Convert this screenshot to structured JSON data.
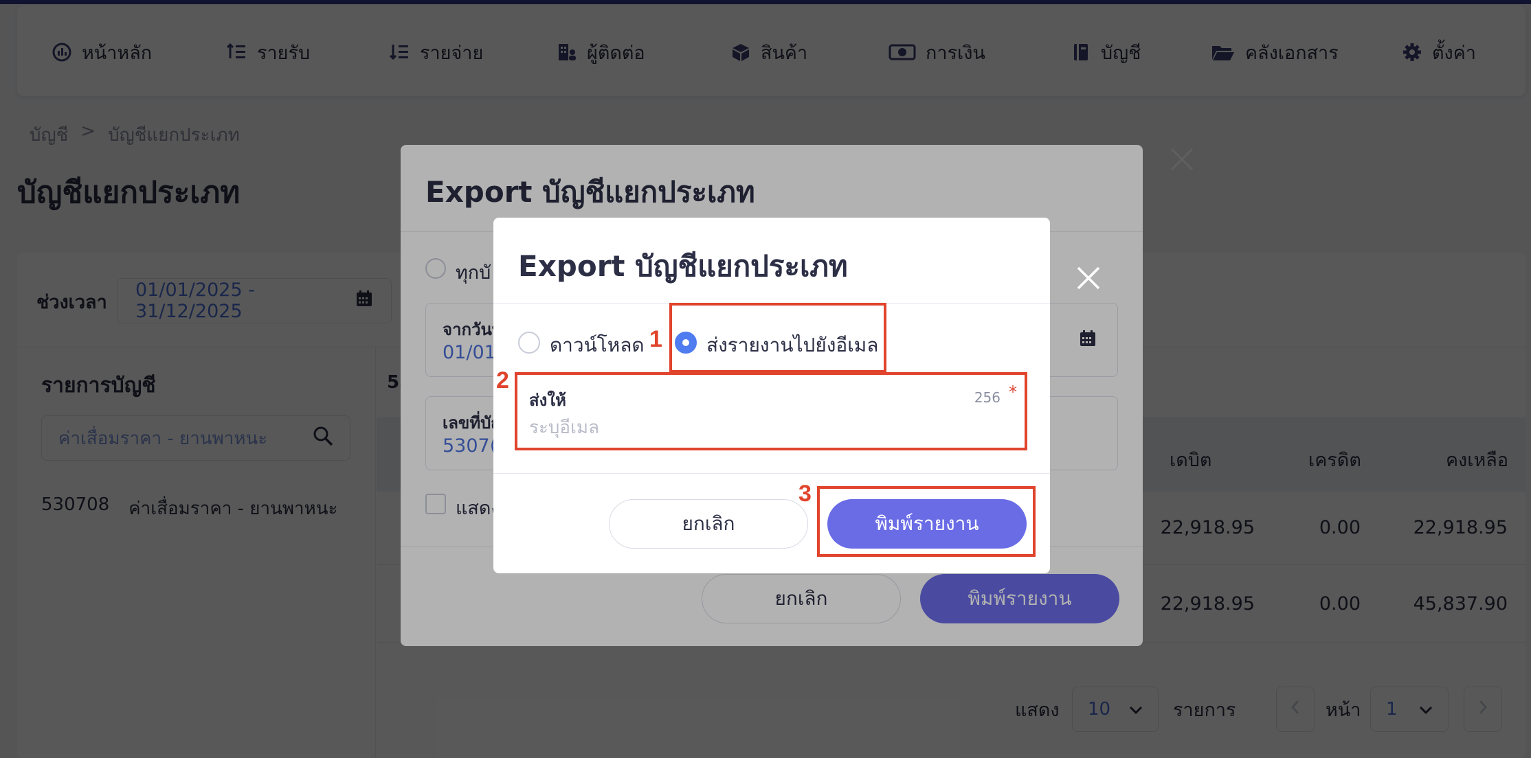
{
  "nav": {
    "items": [
      {
        "label": "หน้าหลัก",
        "icon": "dashboard-icon"
      },
      {
        "label": "รายรับ",
        "icon": "income-list-icon"
      },
      {
        "label": "รายจ่าย",
        "icon": "expense-list-icon"
      },
      {
        "label": "ผู้ติดต่อ",
        "icon": "contacts-building-icon"
      },
      {
        "label": "สินค้า",
        "icon": "box-icon"
      },
      {
        "label": "การเงิน",
        "icon": "money-icon"
      },
      {
        "label": "บัญชี",
        "icon": "book-icon"
      },
      {
        "label": "คลังเอกสาร",
        "icon": "folder-icon"
      },
      {
        "label": "ตั้งค่า",
        "icon": "gear-icon"
      }
    ]
  },
  "breadcrumb": {
    "root": "บัญชี",
    "separator": ">",
    "current": "บัญชีแยกประเภท"
  },
  "page": {
    "title": "บัญชีแยกประเภท",
    "period_label": "ช่วงเวลา",
    "period_value": "01/01/2025 - 31/12/2025"
  },
  "left_panel": {
    "title": "รายการบัญชี",
    "search_value": "ค่าเสื่อมราคา - ยานพาหนะ",
    "item_code": "530708",
    "item_name": "ค่าเสื่อมราคา - ยานพาหนะ"
  },
  "table": {
    "ghost_code": "53",
    "headers": {
      "debit": "เดบิต",
      "credit": "เครดิต",
      "balance": "คงเหลือ"
    },
    "rows": [
      {
        "debit": "22,918.95",
        "credit": "0.00",
        "balance": "22,918.95"
      },
      {
        "debit": "22,918.95",
        "credit": "0.00",
        "balance": "45,837.90"
      }
    ]
  },
  "pager": {
    "show_label": "แสดง",
    "page_size": "10",
    "items_label": "รายการ",
    "page_label": "หน้า",
    "page_value": "1"
  },
  "modal_back": {
    "title": "Export บัญชีแยกประเภท",
    "radio_partial": "ทุกบั",
    "from_label_partial": "จากวันที่",
    "from_value_partial": "01/01",
    "account_label_partial": "เลขที่บัญ",
    "account_value_partial": "5307(",
    "checkbox_partial": "แสดง",
    "cancel": "ยกเลิก",
    "print": "พิมพ์รายงาน"
  },
  "modal_front": {
    "title": "Export บัญชีแยกประเภท",
    "option_download": "ดาวน์โหลด",
    "option_email": "ส่งรายงานไปยังอีเมล",
    "selected_option": "email",
    "email_label": "ส่งให้",
    "email_counter": "256",
    "email_required_mark": "*",
    "email_placeholder": "ระบุอีเมล",
    "email_value": "",
    "cancel": "ยกเลิก",
    "print": "พิมพ์รายงาน"
  },
  "annotations": {
    "step1": "1",
    "step2": "2",
    "step3": "3"
  },
  "colors": {
    "primary": "#6a6ce6",
    "radio_selected": "#4f7cf0",
    "highlight": "#e0442c",
    "link_blue": "#4b6fd8"
  }
}
